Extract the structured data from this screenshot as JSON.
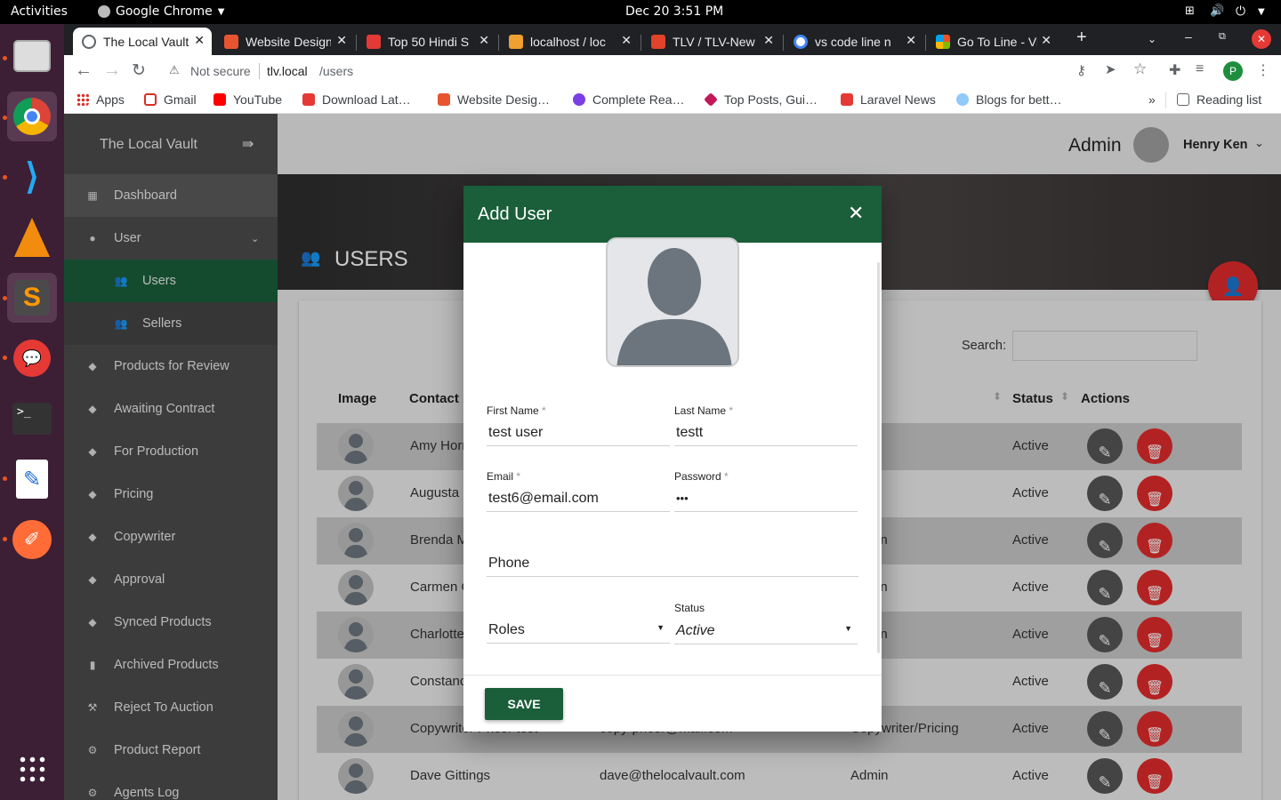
{
  "os": {
    "activities": "Activities",
    "app_name": "Google Chrome",
    "datetime": "Dec 20  3:51 PM"
  },
  "browser": {
    "tabs": [
      {
        "title": "The Local Vault",
        "color": "#5f6368"
      },
      {
        "title": "Website Design",
        "color": "#e8542f"
      },
      {
        "title": "Top 50 Hindi S",
        "color": "#e53935"
      },
      {
        "title": "localhost / loc",
        "color": "#f0a030"
      },
      {
        "title": "TLV / TLV-New",
        "color": "#e2432a"
      },
      {
        "title": "vs code line n",
        "color": "#4285f4"
      },
      {
        "title": "Go To Line - Vi",
        "color": "#f25022"
      }
    ],
    "not_secure": "Not secure",
    "url_host": "tlv.local",
    "url_path": "/users",
    "profile_initial": "P",
    "bookmarks": [
      {
        "label": "Apps",
        "color": "#d93025"
      },
      {
        "label": "Gmail",
        "color": "#d93025"
      },
      {
        "label": "YouTube",
        "color": "#ff0000"
      },
      {
        "label": "Download Lat…",
        "color": "#e53935"
      },
      {
        "label": "Website Desig…",
        "color": "#e8542f"
      },
      {
        "label": "Complete Rea…",
        "color": "#7b3fe4"
      },
      {
        "label": "Top Posts, Gui…",
        "color": "#c2185b"
      },
      {
        "label": "Laravel News",
        "color": "#e53935"
      },
      {
        "label": "Blogs for bett…",
        "color": "#90caf9"
      }
    ],
    "reading_list": "Reading list"
  },
  "app": {
    "brand": "The Local Vault",
    "role": "Admin",
    "user_name": "Henry Ken",
    "page_title": "USERS",
    "search_label": "Search:",
    "sidebar": [
      {
        "label": "Dashboard",
        "icon": "▦"
      },
      {
        "label": "User",
        "icon": "●"
      },
      {
        "label": "Users",
        "icon": "👥"
      },
      {
        "label": "Sellers",
        "icon": "👥"
      },
      {
        "label": "Products for Review",
        "icon": "◆"
      },
      {
        "label": "Awaiting Contract",
        "icon": "◆"
      },
      {
        "label": "For Production",
        "icon": "◆"
      },
      {
        "label": "Pricing",
        "icon": "◆"
      },
      {
        "label": "Copywriter",
        "icon": "◆"
      },
      {
        "label": "Approval",
        "icon": "◆"
      },
      {
        "label": "Synced Products",
        "icon": "◆"
      },
      {
        "label": "Archived Products",
        "icon": "▮"
      },
      {
        "label": "Reject To Auction",
        "icon": "⚒"
      },
      {
        "label": "Product Report",
        "icon": "⚙"
      },
      {
        "label": "Agents Log",
        "icon": "⚙"
      }
    ],
    "table": {
      "headers": {
        "image": "Image",
        "contact": "Contact N",
        "status": "Status",
        "actions": "Actions"
      },
      "rows": [
        {
          "name": "Amy Horn",
          "email": "",
          "role": "t",
          "status": "Active"
        },
        {
          "name": "Augusta B",
          "email": "",
          "role": "t",
          "status": "Active"
        },
        {
          "name": "Brenda M",
          "email": "",
          "role": "in",
          "status": "Active"
        },
        {
          "name": "Carmen C",
          "email": "",
          "role": "in",
          "status": "Active"
        },
        {
          "name": "Charlotte",
          "email": "",
          "role": "in",
          "status": "Active"
        },
        {
          "name": "Constance",
          "email": "",
          "role": "t",
          "status": "Active"
        },
        {
          "name": "Copywriter Pricer test",
          "email": "copy-pricer@mail.com",
          "role": "Copywriter/Pricing",
          "status": "Active"
        },
        {
          "name": "Dave Gittings",
          "email": "dave@thelocalvault.com",
          "role": "Admin",
          "status": "Active"
        }
      ]
    }
  },
  "modal": {
    "title": "Add User",
    "first_name_label": "First Name",
    "first_name_value": "test user",
    "last_name_label": "Last Name",
    "last_name_value": "testt",
    "email_label": "Email",
    "email_value": "test6@email.com",
    "password_label": "Password",
    "password_value": "•••",
    "required_mark": "*",
    "phone_placeholder": "Phone",
    "roles_placeholder": "Roles",
    "status_label": "Status",
    "status_value": "Active",
    "save_label": "SAVE"
  },
  "colors": {
    "primary": "#1a5e3a",
    "danger": "#e02b2b",
    "sidebar": "#4b4b4b"
  }
}
